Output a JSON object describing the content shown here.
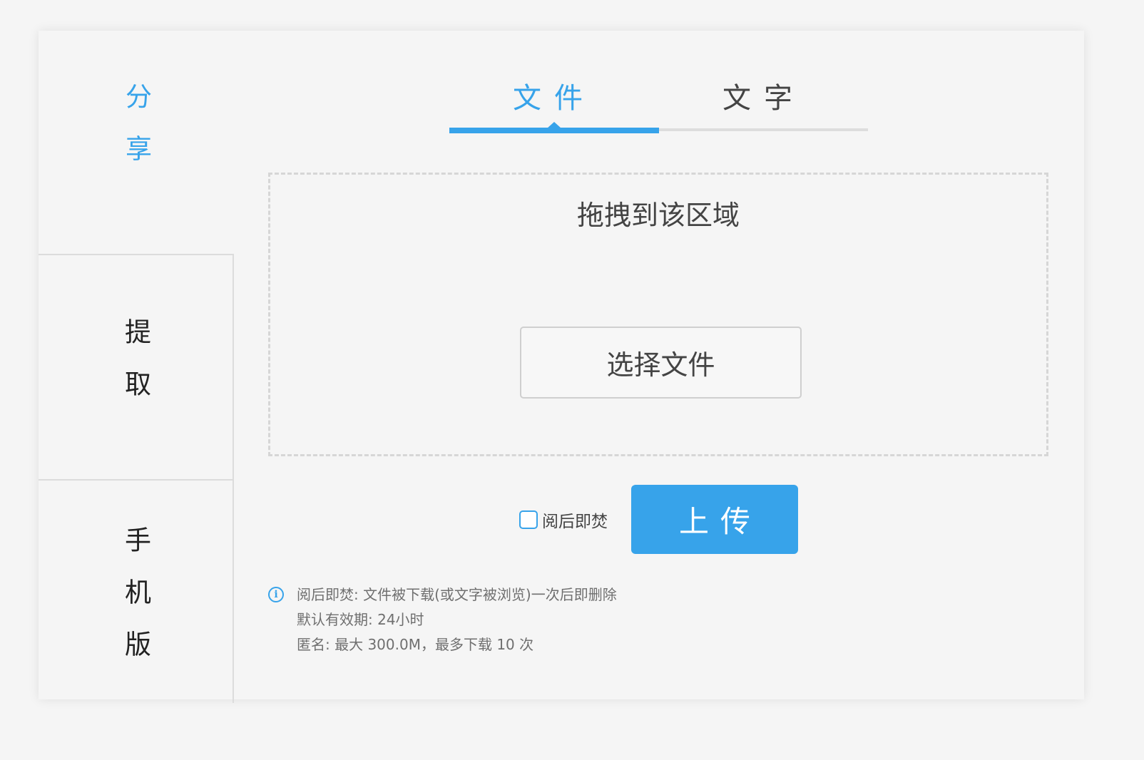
{
  "sidebar": {
    "share": "分享",
    "extract": "提取",
    "mobile": "手机版"
  },
  "tabs": [
    {
      "label": "文件",
      "active": true
    },
    {
      "label": "文字",
      "active": false
    }
  ],
  "dropzone": {
    "title": "拖拽到该区域",
    "choose_button": "选择文件"
  },
  "options": {
    "burn_after_read_label": "阅后即焚",
    "burn_after_read_checked": false
  },
  "upload_button": "上传",
  "info": {
    "icon": "info-icon",
    "lines": [
      "阅后即焚: 文件被下载(或文字被浏览)一次后即删除",
      "默认有效期: 24小时",
      "匿名: 最大 300.0M，最多下载 10 次"
    ]
  },
  "colors": {
    "accent": "#37a3ea",
    "background": "#f5f5f5"
  }
}
